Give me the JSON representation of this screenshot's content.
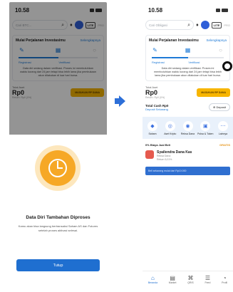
{
  "left": {
    "status_time": "10.58",
    "search_placeholder": "Cari BTC...",
    "lite_label": "LITE",
    "pro_label": "PRO",
    "journey_title": "Mulai Perjalanan Investasimu",
    "journey_link": "Selengkapnya",
    "steps": [
      "Registrasi",
      "Verifikasi",
      ""
    ],
    "journey_progress": 0.5,
    "journey_notice": "Data diri sedang dalam verifikasi. Proses ini membutuhkan waktu kurang dari 24 jam tetapi bisa lebih lama jika pembukaan akun dilakukan di luar hari bursa.",
    "asset_label": "Total Aset",
    "asset_value": "Rp0",
    "asset_return": "Return: Rp0 (0%)",
    "asset_button": "MASUKAN RP DANA",
    "sheet_title": "Data Diri Tambahan Diproses",
    "sheet_body": "Kamu akan bisa langsung bertransaksi Saham AS dan Futures setelah proses aktivasi selesai.",
    "close_button": "Tutup"
  },
  "right": {
    "status_time": "10.58",
    "search_placeholder": "Cari Obligasi",
    "lite_label": "LITE",
    "pro_label": "PRO",
    "journey_title": "Mulai Perjalanan Investasimu",
    "journey_link": "Selengkapnya",
    "steps": [
      "Registrasi",
      "Verifikasi",
      ""
    ],
    "journey_progress": 0.5,
    "journey_notice": "Data diri sedang dalam verifikasi. Proses ini membutuhkan waktu kurang dari 24 jam tetapi bisa lebih lama jika pembukaan akun dilakukan di luar hari bursa.",
    "asset_label": "Total Aset",
    "asset_value": "Rp0",
    "asset_return": "Return: Rp0 (0%)",
    "asset_button": "MASUKAN RP DANA",
    "cash_label": "Total Cash Rp0",
    "cash_link": "Deposit Sekarang",
    "deposit_button": "Deposit",
    "menu": [
      {
        "icon": "saham-icon",
        "glyph": "◆",
        "label": "Saham"
      },
      {
        "icon": "crypto-icon",
        "glyph": "◎",
        "label": "Aset Kripto"
      },
      {
        "icon": "reksa-dana-icon",
        "glyph": "◉",
        "label": "Reksa Dana"
      },
      {
        "icon": "pulsa-icon",
        "glyph": "▣",
        "label": "Pulsa & Token"
      },
      {
        "icon": "more-icon",
        "glyph": "⋯",
        "label": "Lainnya"
      }
    ],
    "promo_head": "0% Biaya Jual Beli",
    "promo_tag": "GRATIS",
    "promo_title": "Syailendra Dana Kas",
    "promo_sub1": "Reksa Dana",
    "promo_sub2": "Return 5,01%",
    "mini_banner": "Beli sekarang mulai dari Rp10.000",
    "nav": [
      {
        "icon": "home-icon",
        "glyph": "⌂",
        "label": "Beranda",
        "active": true
      },
      {
        "icon": "market-icon",
        "glyph": "▤",
        "label": "Market",
        "active": false
      },
      {
        "icon": "qris-icon",
        "glyph": "⌘",
        "label": "QRIS",
        "active": false
      },
      {
        "icon": "feed-icon",
        "glyph": "☰",
        "label": "Feed",
        "active": false
      },
      {
        "icon": "profile-icon",
        "glyph": "◔",
        "label": "Profil",
        "active": false
      }
    ]
  },
  "colors": {
    "primary": "#1f6fd0",
    "accent_yellow": "#f7b500",
    "clock_orange": "#f6a826",
    "arrow": "#2d6fd8"
  }
}
